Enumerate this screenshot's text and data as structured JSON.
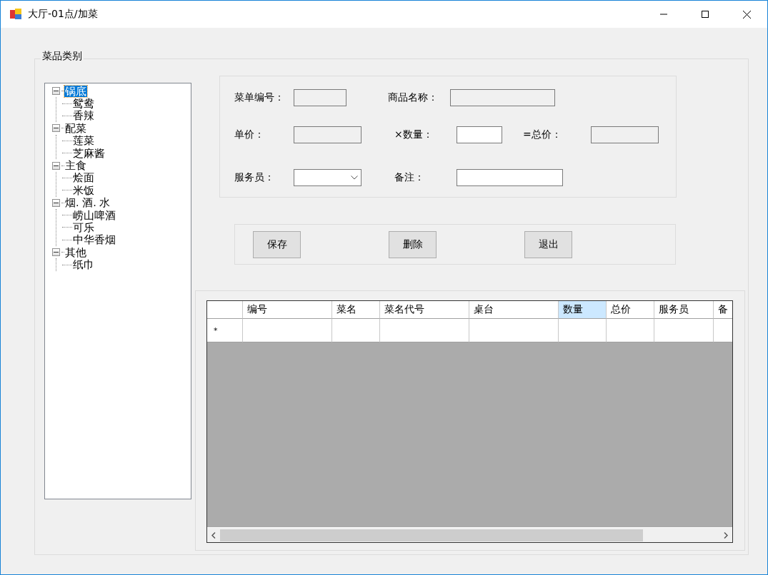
{
  "window": {
    "title": "大厅-01点/加菜"
  },
  "category_group": {
    "label": "菜品类别"
  },
  "tree": [
    {
      "label": "锅底",
      "selected": true,
      "expanded": true,
      "children": [
        {
          "label": "鸳鸯",
          "selected": false
        },
        {
          "label": "香辣",
          "selected": false
        }
      ]
    },
    {
      "label": "配菜",
      "selected": false,
      "expanded": true,
      "children": [
        {
          "label": "莲菜",
          "selected": false
        },
        {
          "label": "芝麻酱",
          "selected": false
        }
      ]
    },
    {
      "label": "主食",
      "selected": false,
      "expanded": true,
      "children": [
        {
          "label": "烩面",
          "selected": false
        },
        {
          "label": "米饭",
          "selected": false
        }
      ]
    },
    {
      "label": "烟. 酒. 水",
      "selected": false,
      "expanded": true,
      "children": [
        {
          "label": "崂山啤酒",
          "selected": false
        },
        {
          "label": "可乐",
          "selected": false
        },
        {
          "label": "中华香烟",
          "selected": false
        }
      ]
    },
    {
      "label": "其他",
      "selected": false,
      "expanded": true,
      "children": [
        {
          "label": "纸巾",
          "selected": false
        }
      ]
    }
  ],
  "form_rows": [
    [
      {
        "label": "菜单编号：",
        "kind": "text",
        "disabled": true
      },
      {
        "label": "商品名称：",
        "kind": "text",
        "disabled": true
      }
    ],
    [
      {
        "label": "单价：",
        "kind": "text",
        "disabled": true
      },
      {
        "label": "×数量：",
        "kind": "text",
        "disabled": false
      },
      {
        "label": "=总价：",
        "kind": "text",
        "disabled": true
      }
    ],
    [
      {
        "label": "服务员：",
        "kind": "combo",
        "disabled": false
      },
      {
        "label": "备注：",
        "kind": "text",
        "disabled": false
      }
    ]
  ],
  "buttons": [
    "保存",
    "删除",
    "退出"
  ],
  "table": {
    "new_row_marker": "*",
    "columns": [
      {
        "label": "编号",
        "selected": false
      },
      {
        "label": "菜名",
        "selected": false
      },
      {
        "label": "菜名代号",
        "selected": false
      },
      {
        "label": "桌台",
        "selected": false
      },
      {
        "label": "数量",
        "selected": true
      },
      {
        "label": "总价",
        "selected": false
      },
      {
        "label": "服务员",
        "selected": false
      },
      {
        "label": "备",
        "selected": false
      }
    ]
  }
}
